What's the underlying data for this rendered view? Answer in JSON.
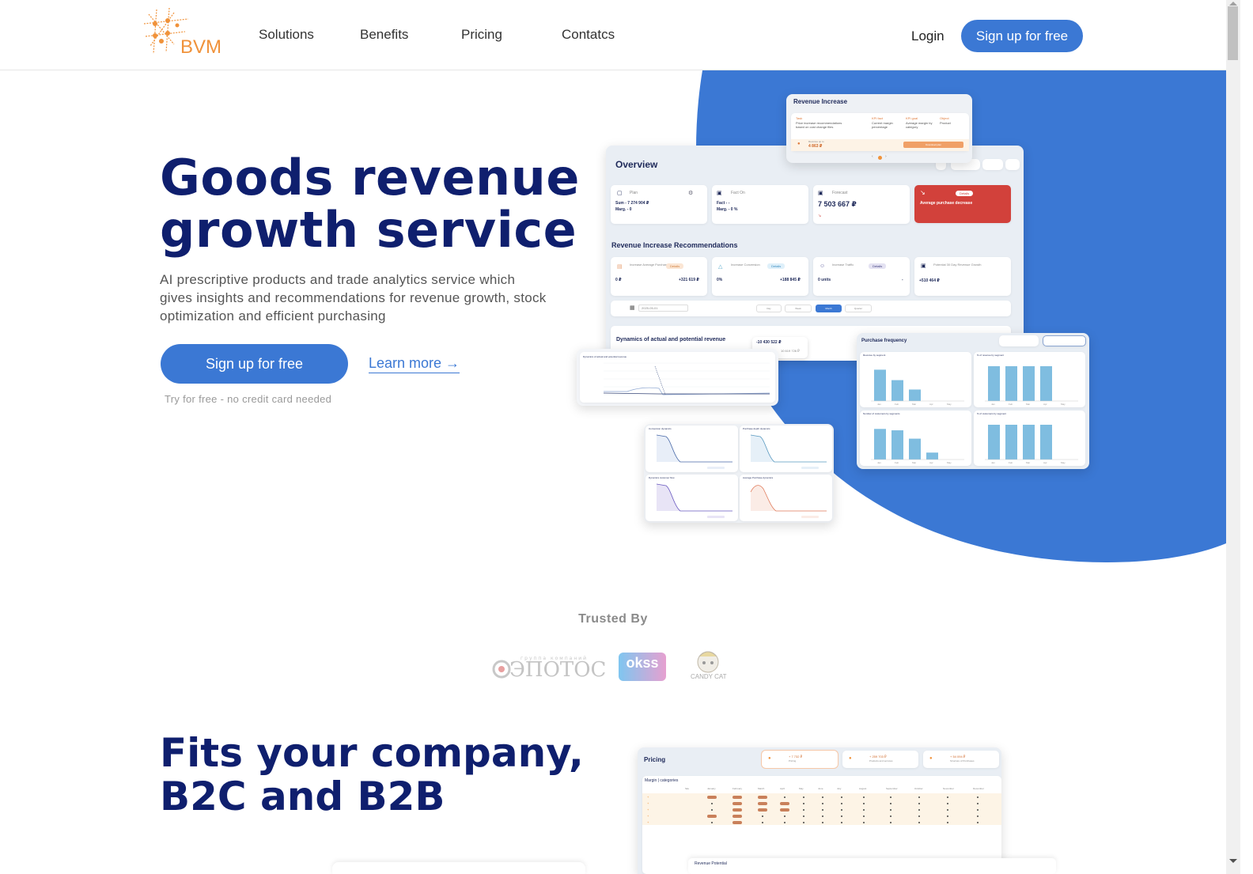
{
  "header": {
    "logo_text": "BVM",
    "nav": [
      "Solutions",
      "Benefits",
      "Pricing",
      "Contatcs"
    ],
    "login": "Login",
    "signup": "Sign up for free"
  },
  "hero": {
    "title_line1": "Goods revenue",
    "title_line2": "growth service",
    "subtitle": "AI prescriptive products and trade analytics service which gives insights and recommendations for revenue growth, stock optimization and efficient purchasing",
    "signup": "Sign up for free",
    "learn_more": "Learn more →",
    "note": "Try for free - no credit card needed"
  },
  "mockups": {
    "revenue_increase": {
      "title": "Revenue Increase",
      "task_label": "Task",
      "task_text": "Price increase recommendations based on cost change files",
      "kpi_fact_label": "KPI fact",
      "kpi_fact_text": "Current margin percentage",
      "kpi_goal_label": "KPI goal",
      "kpi_goal_text": "Average margin by category",
      "object_label": "Object",
      "object_text": "Product",
      "revenue_upto_label": "Revenue up to",
      "revenue_upto_value": "4 863 ₽",
      "action_button": "Download plan"
    },
    "overview": {
      "title": "Overview",
      "cards": [
        {
          "label": "Plan",
          "line1": "Sum - 7 274 904 ₽",
          "line2": "Marg. - 0"
        },
        {
          "label": "Fact On",
          "line1": "Fact - -",
          "line2": "Marg. - 0 %"
        },
        {
          "label": "Forecast",
          "value": "7 503 667 ₽"
        },
        {
          "label": "Average purchase decrease",
          "button": "Details"
        }
      ]
    },
    "recommendations": {
      "title": "Revenue Increase Recommendations",
      "cards": [
        {
          "label": "Increase Average Purchase",
          "badge": "Details",
          "left": "0 ₽",
          "right": "+321 619 ₽"
        },
        {
          "label": "Increase Conversion",
          "badge": "Details",
          "left": "0%",
          "right": "+188 845 ₽"
        },
        {
          "label": "Increase Traffic",
          "badge": "Details",
          "left": "0 units",
          "right": "-"
        },
        {
          "label": "Potential 30 Day Revenue Growth",
          "left": "+510 464 ₽"
        }
      ],
      "date": "2025-05-01",
      "periods": [
        "Day",
        "Week",
        "Month",
        "Quarter"
      ],
      "active_period": "Month"
    },
    "dynamics": {
      "title": "Dynamics of actual and potential revenue",
      "value1": "-10 430 522 ₽",
      "value2": "10 619 726 ₽",
      "chart_title": "Dynamics of actual and potential revenue"
    },
    "purchase_frequency": {
      "title": "Purchase frequency",
      "charts": [
        "Revenue by segment",
        "% of revenue by segment",
        "Number of customers by segments",
        "% of customers by segment"
      ],
      "months": [
        "Jan",
        "Feb",
        "Mar",
        "Apr",
        "May"
      ],
      "revenue_bars": [
        0.9,
        0.6,
        0.33,
        0,
        0
      ],
      "pct_revenue_bars": [
        1,
        1,
        1,
        1,
        0
      ],
      "customers_bars": [
        0.88,
        0.84,
        0.6,
        0.2,
        0
      ],
      "pct_customers_bars": [
        1,
        1,
        1,
        1,
        0
      ]
    },
    "small_charts": [
      "Conversion dynamics",
      "Purchase depth dynamics",
      "Dynamics customer flow",
      "Average Purchase dynamics"
    ],
    "pricing": {
      "title": "Pricing",
      "kpis": [
        {
          "value": "+ 7 732 ₽",
          "label": "Pricing"
        },
        {
          "value": "+ 259 703 ₽",
          "label": "Products and services"
        },
        {
          "value": "+ 54 094 ₽",
          "label": "Structure of Purchases"
        }
      ],
      "table_selector": "Margin | categories",
      "columns": [
        "Sku",
        "January",
        "February",
        "March",
        "April",
        "May",
        "June",
        "July",
        "August",
        "September",
        "October",
        "November",
        "December"
      ],
      "revenue_potential": "Revenue Potential"
    }
  },
  "trusted": {
    "title": "Trusted By",
    "logos": [
      "ЭПОТОС",
      "okss",
      "CANDY CAT"
    ]
  },
  "section2": {
    "title_line1": "Fits your company,",
    "title_line2": "B2C and B2B"
  },
  "colors": {
    "brand_blue": "#3b78d4",
    "navy": "#0f1f6e",
    "logo_orange": "#f0923a",
    "alert_red": "#d2413b"
  }
}
